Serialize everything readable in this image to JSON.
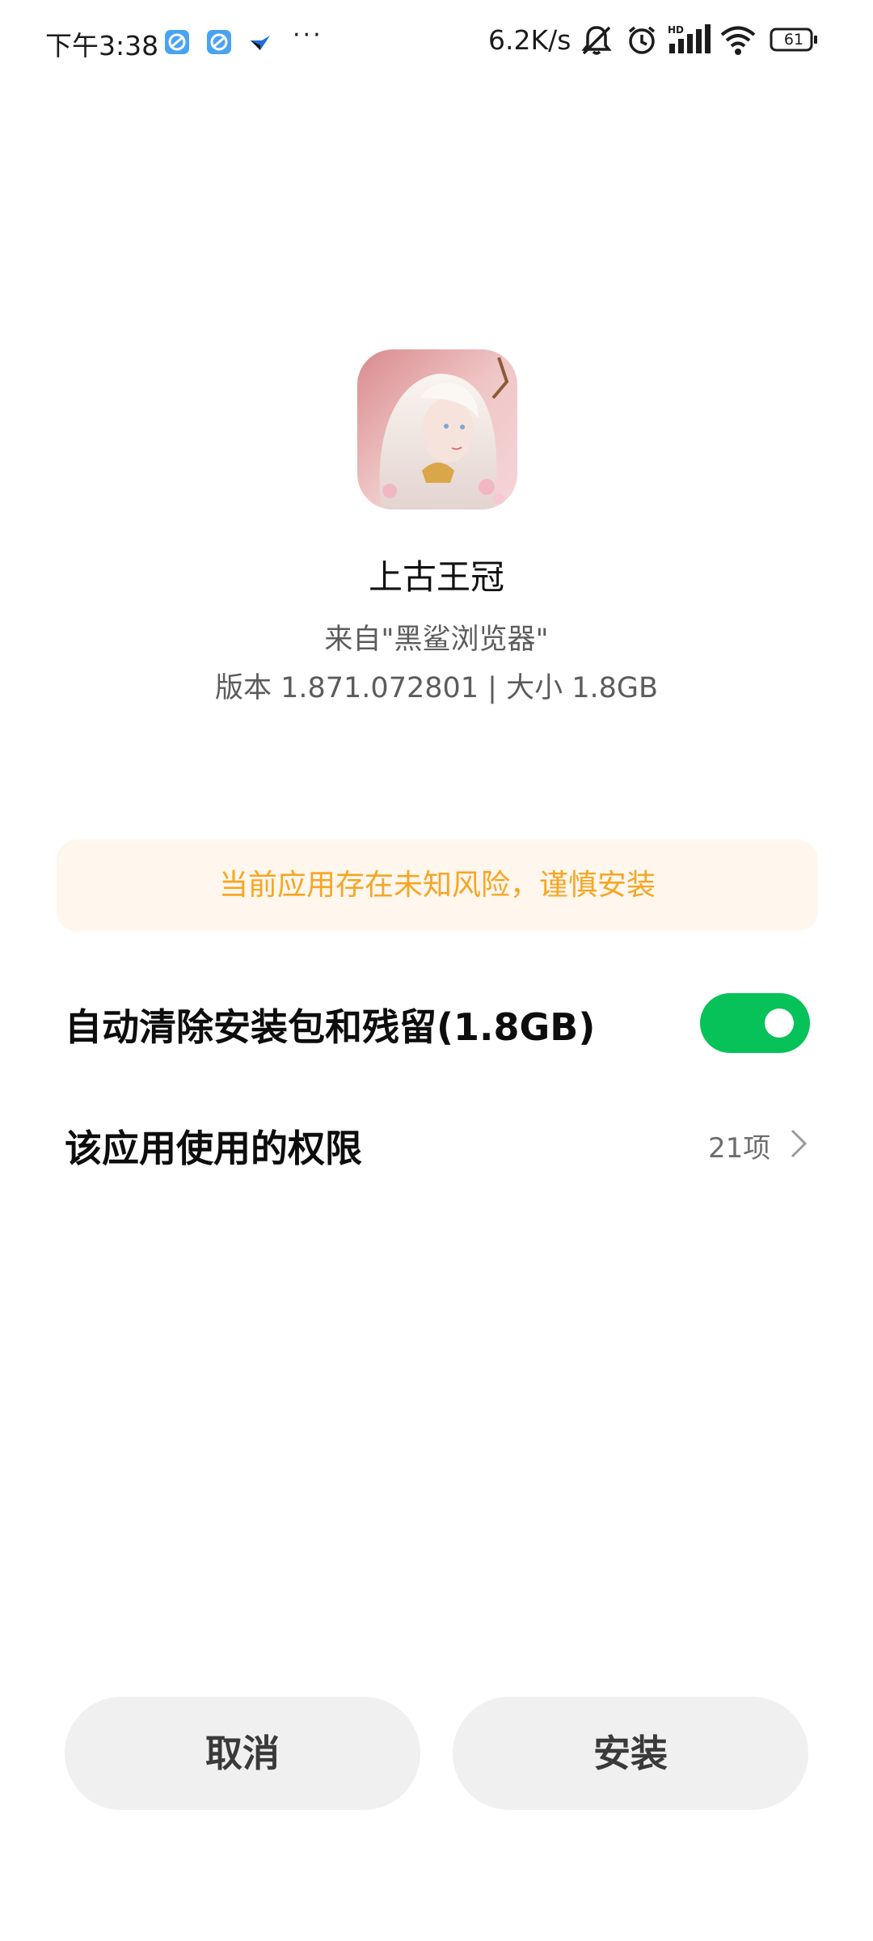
{
  "status_bar": {
    "time": "下午3:38",
    "more_indicator": "···",
    "network_speed": "6.2K/s",
    "battery_level": "61",
    "notification_icons": [
      "browser-app-icon",
      "browser-app-icon",
      "bird-app-icon"
    ],
    "status_icons": [
      "mute-bell-icon",
      "alarm-icon",
      "hd-signal-icon",
      "wifi-icon",
      "battery-icon"
    ]
  },
  "app": {
    "name": "上古王冠",
    "source": "来自\"黑鲨浏览器\"",
    "meta": "版本 1.871.072801 | 大小 1.8GB",
    "icon": "game-character-icon"
  },
  "warning": {
    "text": "当前应用存在未知风险，谨慎安装",
    "color": "#f5a623",
    "background": "#fff6ed"
  },
  "options": {
    "auto_clean_label": "自动清除安装包和残留(1.8GB)",
    "auto_clean_enabled": true,
    "toggle_color": "#06c258",
    "permissions_label": "该应用使用的权限",
    "permissions_count": "21项"
  },
  "buttons": {
    "cancel": "取消",
    "install": "安装"
  }
}
